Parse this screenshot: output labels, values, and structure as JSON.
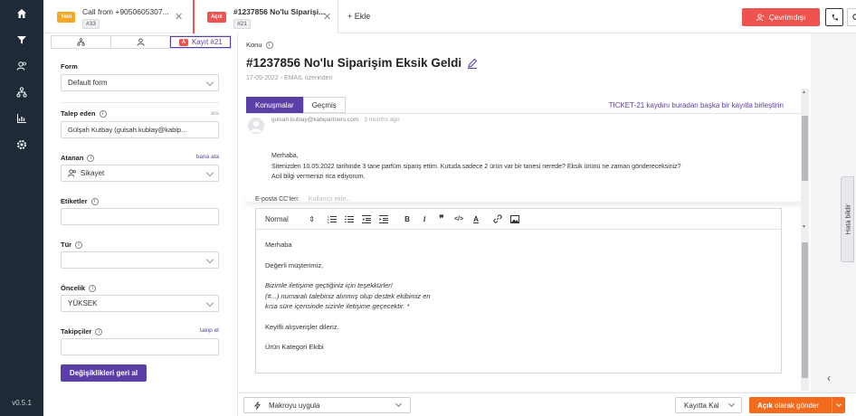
{
  "app": {
    "version": "v0.5.1"
  },
  "colors": {
    "accent": "#5b3fa8",
    "nav_bg": "#1e2a36",
    "danger": "#ef5350",
    "orange": "#f26b1d",
    "new_badge": "#f5a623"
  },
  "nav": {
    "icons": [
      "home-icon",
      "filter-icon",
      "contacts-icon",
      "org-chart-icon",
      "reports-icon",
      "settings-icon"
    ]
  },
  "tabs": [
    {
      "badge": "Yeni",
      "title": "Call from +9050605307...",
      "number": "#33"
    },
    {
      "badge": "Açık",
      "title": "#1237856 No'lu Siparişi...",
      "number": "#21"
    }
  ],
  "topbar": {
    "add_tab": "Ekle",
    "status_button": "Çevrimdışı"
  },
  "left_panel": {
    "subtab_active": "Kayıt #21",
    "form_label": "Form",
    "form_value": "Default form",
    "requester_label": "Talep eden",
    "requester_hint": "ara",
    "requester_value": "Gülşah Kutbay (gulsah.kublay@kabip...",
    "assignee_label": "Atanan",
    "assignee_link": "bana ata",
    "assignee_value": "Sikayet",
    "tags_label": "Etiketler",
    "type_label": "Tür",
    "priority_label": "Öncelik",
    "priority_value": "YÜKSEK",
    "followers_label": "Takipçiler",
    "followers_link": "takip et",
    "revert_button": "Değişiklikleri geri al"
  },
  "ticket": {
    "subject_label": "Konu",
    "subject": "#1237856 No'lu Siparişim Eksik Geldi",
    "meta": "17-05-2022 - EMAIL üzerinden",
    "tab_conversations": "Konuşmalar",
    "tab_history": "Geçmiş",
    "merge_link": "TICKET-21 kaydını buradan başka bir kayıtla birleştirin"
  },
  "message": {
    "sender": "gulsah.kublay@kabipartners.com",
    "time": "3 months ago",
    "greeting": "Merhaba,",
    "line1": "Sitenizden 10.05.2022 tarihinde 3 tane parfüm sipariş ettim. Kutuda sadece 2 ürün var bir tanesi nerede? Eksik ürünü ne zaman göndereceksiniz?",
    "line2": "Acil bilgi vermenizi rica ediyorum."
  },
  "editor": {
    "cc_label": "E-posta CC'leri:",
    "cc_placeholder": "Kullanıcı ekle...",
    "format": "Normal",
    "p1": "Merhaba",
    "p2": "Değerli müşterimiz,",
    "p3a": "Bizimle iletişime geçtiğiniz için teşekkürler!",
    "p3b": "(#...) numaralı talebiniz alınmış olup destek ekibimiz en",
    "p3c": "kısa süre içerisinde sizinle iletişime geçecektir. *",
    "p4": "Keyifli alışverişler dileriz.",
    "p5": "Ürün Kategori Ekibi"
  },
  "side": {
    "help_tab": "Hata bildir"
  },
  "bottom": {
    "macro": "Makroyu uygula",
    "stay": "Kayıtta Kal",
    "send_bold": "Açık",
    "send_rest": "olarak gönder"
  }
}
